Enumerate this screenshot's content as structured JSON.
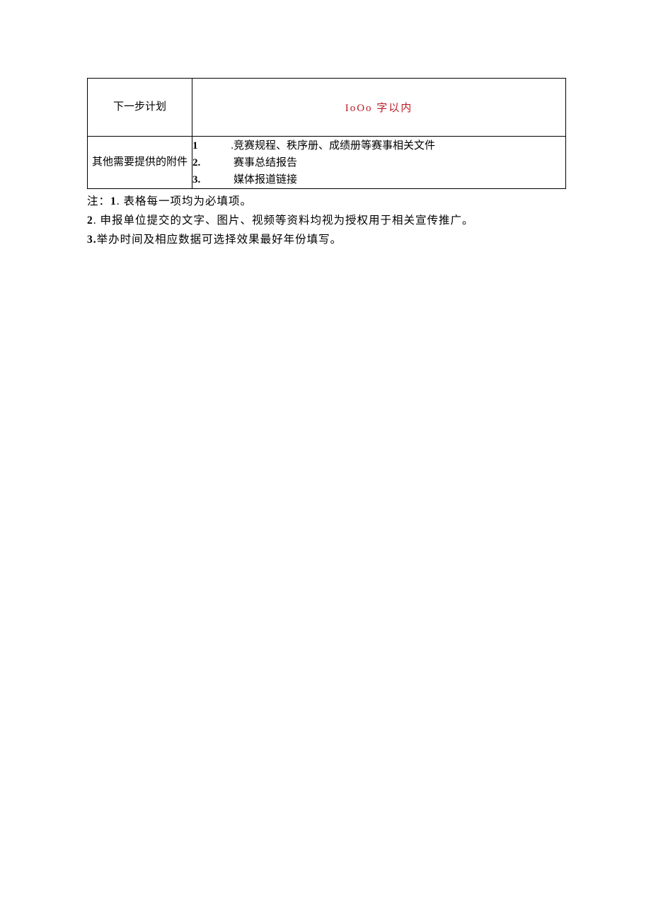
{
  "table": {
    "row1": {
      "label": "下一步计划",
      "value": "IoOo 字以内"
    },
    "row2": {
      "label": "其他需要提供的附件",
      "items": [
        {
          "num": "1",
          "dot": ".",
          "text": "竞赛规程、秩序册、成绩册等赛事相关文件"
        },
        {
          "num": "2.",
          "dot": "",
          "text": "赛事总结报告"
        },
        {
          "num": "3.",
          "dot": "",
          "text": "媒体报道链接"
        }
      ]
    }
  },
  "notes": {
    "n1_pre": "注：",
    "n1_num": "1",
    "n1_txt": ". 表格每一项均为必填项。",
    "n2_num": "2",
    "n2_txt": ". 申报单位提交的文字、图片、视频等资料均视为授权用于相关宣传推广。",
    "n3_num": "3.",
    "n3_txt": "举办时间及相应数据可选择效果最好年份填写。"
  }
}
